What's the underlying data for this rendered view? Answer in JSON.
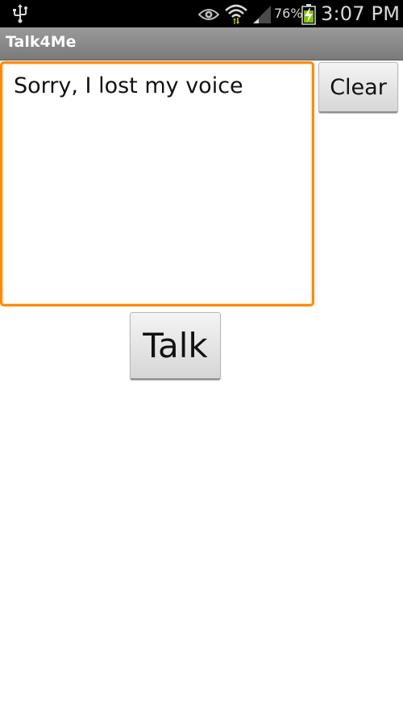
{
  "status_bar": {
    "battery_percent": "76%",
    "time": "3:07 PM",
    "icons": [
      "usb-icon",
      "eye-icon",
      "wifi-icon",
      "signal-icon",
      "battery-charging-icon"
    ]
  },
  "title_bar": {
    "title": "Talk4Me"
  },
  "main": {
    "text_value": "Sorry, I lost my voice",
    "clear_label": "Clear",
    "talk_label": "Talk"
  },
  "colors": {
    "focus_border": "#ff8a00",
    "battery_green": "#7cc400"
  }
}
